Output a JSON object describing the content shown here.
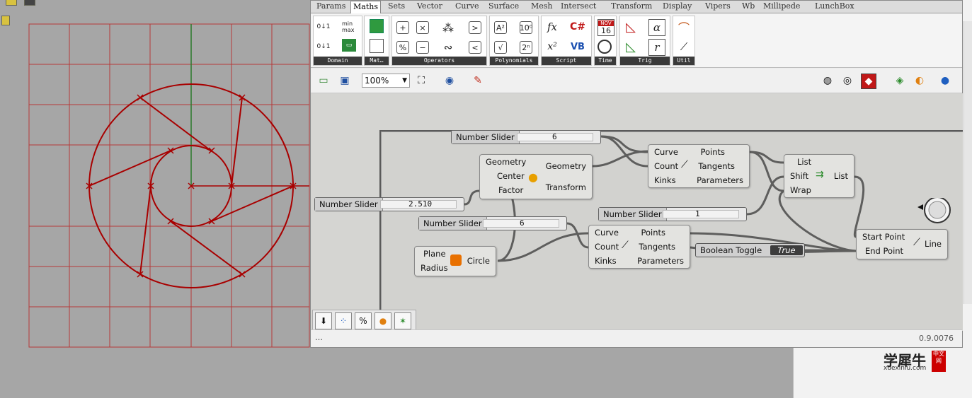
{
  "tabs": [
    "Params",
    "Maths",
    "Sets",
    "Vector",
    "Curve",
    "Surface",
    "Mesh",
    "Intersect",
    "Transform",
    "Display",
    "Vipers",
    "Wb",
    "Millipede",
    "LunchBox"
  ],
  "active_tab": "Maths",
  "ribbon_groups": [
    "Domain",
    "Mat…",
    "Operators",
    "Polynomials",
    "Script",
    "Time",
    "Trig",
    "Util"
  ],
  "ribbon_icons": {
    "domain": [
      "0↓1",
      "min max",
      "0↓1",
      "▭"
    ],
    "operators": [
      "+",
      "×",
      "%",
      "−",
      ">",
      "<"
    ],
    "polynomials": [
      "A²",
      "10⁰",
      "√",
      "2ⁿ"
    ],
    "script": [
      "fx",
      "C#",
      "x²",
      "VB"
    ],
    "time": [
      "NOV",
      "16"
    ],
    "trig": [
      "α",
      "r"
    ]
  },
  "toolbar": {
    "zoom": "100%"
  },
  "sliders": [
    {
      "name": "Number Slider",
      "value": "6"
    },
    {
      "name": "Number Slider",
      "value": "2.510"
    },
    {
      "name": "Number Slider",
      "value": "6"
    },
    {
      "name": "Number Slider",
      "value": "1"
    }
  ],
  "components": {
    "scale": {
      "inputs": [
        "Geometry",
        "Center",
        "Factor"
      ],
      "outputs": [
        "Geometry",
        "Transform"
      ]
    },
    "divide_top": {
      "inputs": [
        "Curve",
        "Count",
        "Kinks"
      ],
      "outputs": [
        "Points",
        "Tangents",
        "Parameters"
      ]
    },
    "divide_bottom": {
      "inputs": [
        "Curve",
        "Count",
        "Kinks"
      ],
      "outputs": [
        "Points",
        "Tangents",
        "Parameters"
      ]
    },
    "shift": {
      "inputs": [
        "List",
        "Shift",
        "Wrap"
      ],
      "outputs": [
        "List"
      ]
    },
    "circle": {
      "inputs": [
        "Plane",
        "Radius"
      ],
      "outputs": [
        "Circle"
      ]
    },
    "line": {
      "inputs": [
        "Start Point",
        "End Point"
      ],
      "outputs": [
        "Line"
      ]
    }
  },
  "toggle": {
    "name": "Boolean Toggle",
    "state": "True"
  },
  "status": {
    "version": "0.9.0076",
    "left": "…"
  },
  "watermark": {
    "text": "学犀牛",
    "url": "xuexiniu.com",
    "seal": "中文网"
  },
  "colors": {
    "curve": "#a80000",
    "grid": "#b03030",
    "axis_y": "#2c7a2c",
    "wire": "#505050"
  }
}
